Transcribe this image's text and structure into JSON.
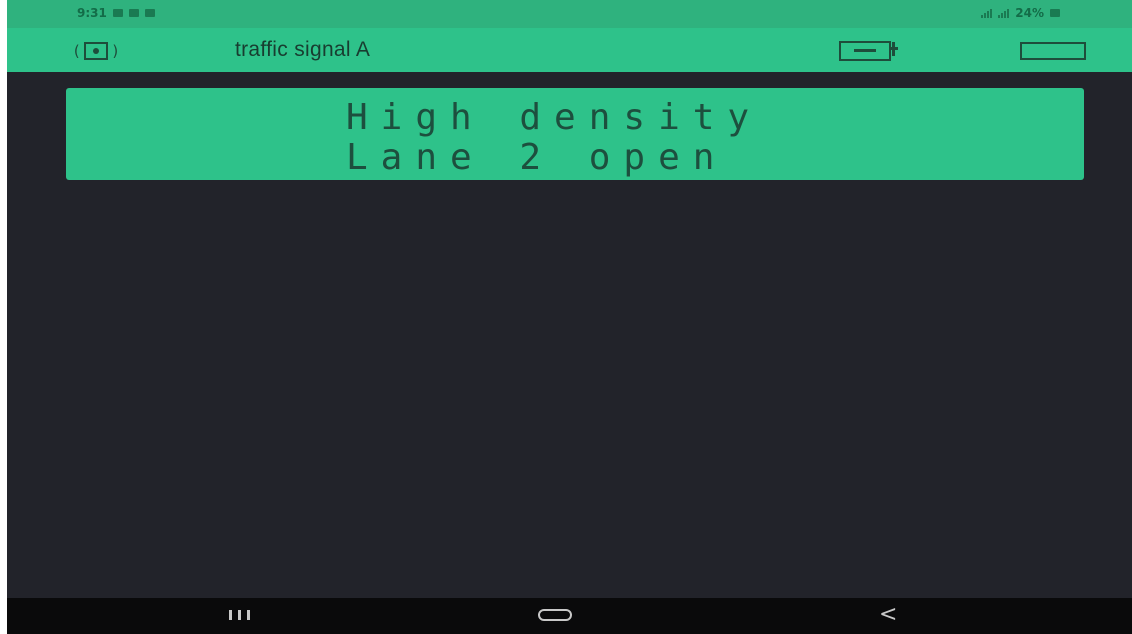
{
  "status_bar": {
    "time": "9:31",
    "battery": "24%"
  },
  "header": {
    "title": "traffic signal A",
    "left_icon": "device-frame-icon",
    "right_icons": [
      "device-connection-icon",
      "menu-icon"
    ]
  },
  "lcd": {
    "line1": "High density",
    "line2": "Lane 2 open"
  },
  "nav": {
    "recents_icon": "recents-icon",
    "home_icon": "home-icon",
    "back_label": "<"
  },
  "colors": {
    "accent": "#2ec28a",
    "background": "#22232a",
    "lcd_text": "#1d4f3e",
    "nav_bar": "#0a0a0b"
  }
}
